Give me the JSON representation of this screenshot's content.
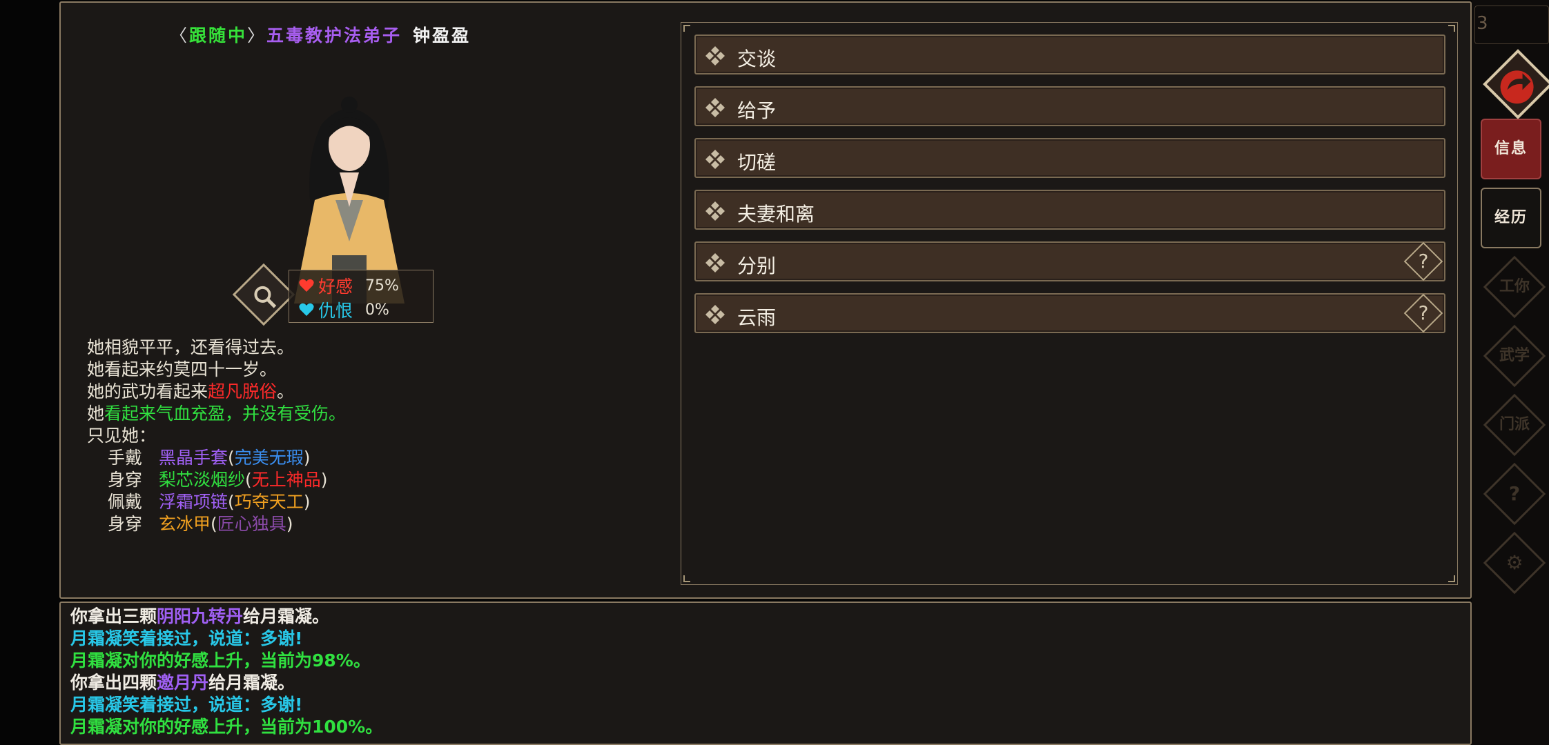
{
  "header": {
    "bracket_open": "〈",
    "status": "跟随中",
    "bracket_close": "〉",
    "sect_title": "五毒教护法弟子",
    "npc_name": "钟盈盈"
  },
  "relations": {
    "like_label": "好感",
    "like_value": "75%",
    "hate_label": "仇恨",
    "hate_value": "0%"
  },
  "description": {
    "line1": "她相貌平平，还看得过去。",
    "line2": "她看起来约莫四十一岁。",
    "line3_prefix": "她的武功看起来",
    "line3_hl": "超凡脱俗",
    "line3_suffix": "。",
    "line4_prefix": "她",
    "line4_hl": "看起来气血充盈，并没有受伤。",
    "line5": "只见她：",
    "equipment": [
      {
        "slot": "手戴",
        "item": "黑晶手套",
        "quality": "完美无瑕"
      },
      {
        "slot": "身穿",
        "item": "梨芯淡烟纱",
        "quality": "无上神品"
      },
      {
        "slot": "佩戴",
        "item": "浮霜项链",
        "quality": "巧夺天工"
      },
      {
        "slot": "身穿",
        "item": "玄冰甲",
        "quality": "匠心独具"
      }
    ],
    "paren_open": "(",
    "paren_close": ")"
  },
  "options": [
    {
      "label": "交谈"
    },
    {
      "label": "给予"
    },
    {
      "label": "切磋"
    },
    {
      "label": "夫妻和离"
    },
    {
      "label": "分别",
      "help": "?"
    },
    {
      "label": "云雨",
      "help": "?"
    }
  ],
  "sidebar": {
    "top_fragment": "3",
    "info_label": "信息",
    "history_label": "经历",
    "dim_1": "工你",
    "dim_2": "武学",
    "dim_3": "门派",
    "dim_4": "?",
    "dim_5": "⚙"
  },
  "log": {
    "l1_prefix": "你拿出三颗",
    "l1_item": "阴阳九转丹",
    "l1_suffix": "给月霜凝。",
    "l2": "月霜凝笑着接过，说道：多谢!",
    "l3": "月霜凝对你的好感上升，当前为98%。",
    "l4_prefix": "你拿出四颗",
    "l4_item": "邀月丹",
    "l4_suffix": "给月霜凝。",
    "l5": "月霜凝笑着接过，说道：多谢!",
    "l6": "月霜凝对你的好感上升，当前为100%。"
  },
  "colors": {
    "panel_bg": "#1b1816",
    "panel_border": "#8a7a62",
    "option_bg": "#3e2f24",
    "active_tab": "#7a1e1e"
  }
}
